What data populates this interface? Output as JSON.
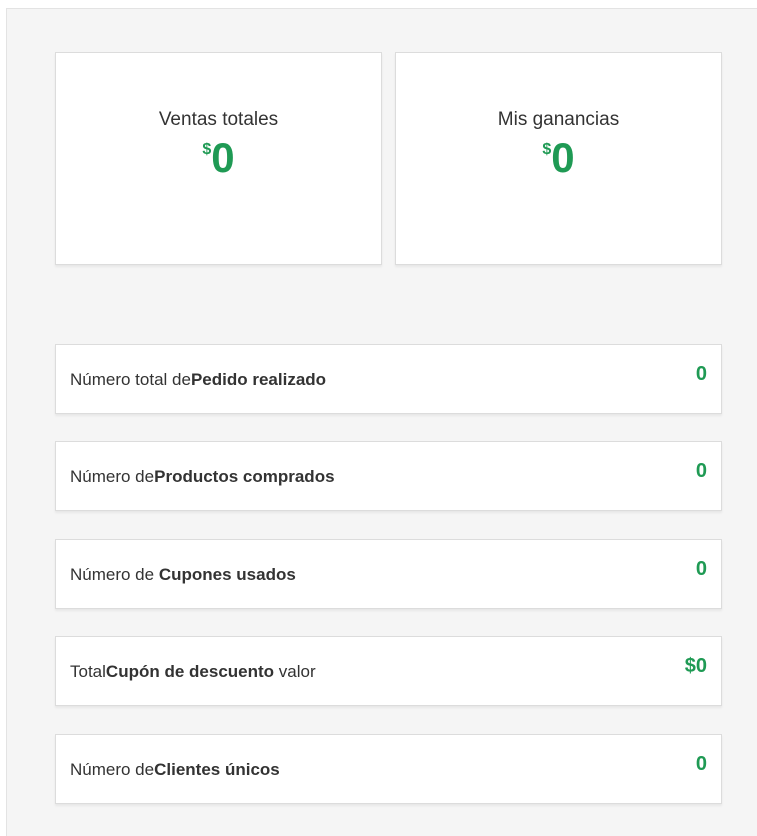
{
  "summary": {
    "total_sales": {
      "label": "Ventas totales",
      "currency": "$",
      "value": "0"
    },
    "my_earnings": {
      "label": "Mis ganancias",
      "currency": "$",
      "value": "0"
    }
  },
  "stats": [
    {
      "prefix": "Número total de",
      "bold": "Pedido realizado",
      "suffix": "",
      "value": "0"
    },
    {
      "prefix": "Número de",
      "bold": "Productos comprados",
      "suffix": "",
      "value": "0"
    },
    {
      "prefix": "Número de ",
      "bold": "Cupones usados",
      "suffix": "",
      "value": "0"
    },
    {
      "prefix": "Total",
      "bold": "Cupón de descuento",
      "suffix": " valor",
      "value": "$0"
    },
    {
      "prefix": "Número de",
      "bold": "Clientes únicos",
      "suffix": "",
      "value": "0"
    }
  ],
  "colors": {
    "accent": "#1f9a54",
    "text": "#333333",
    "panel": "#f5f5f5"
  }
}
